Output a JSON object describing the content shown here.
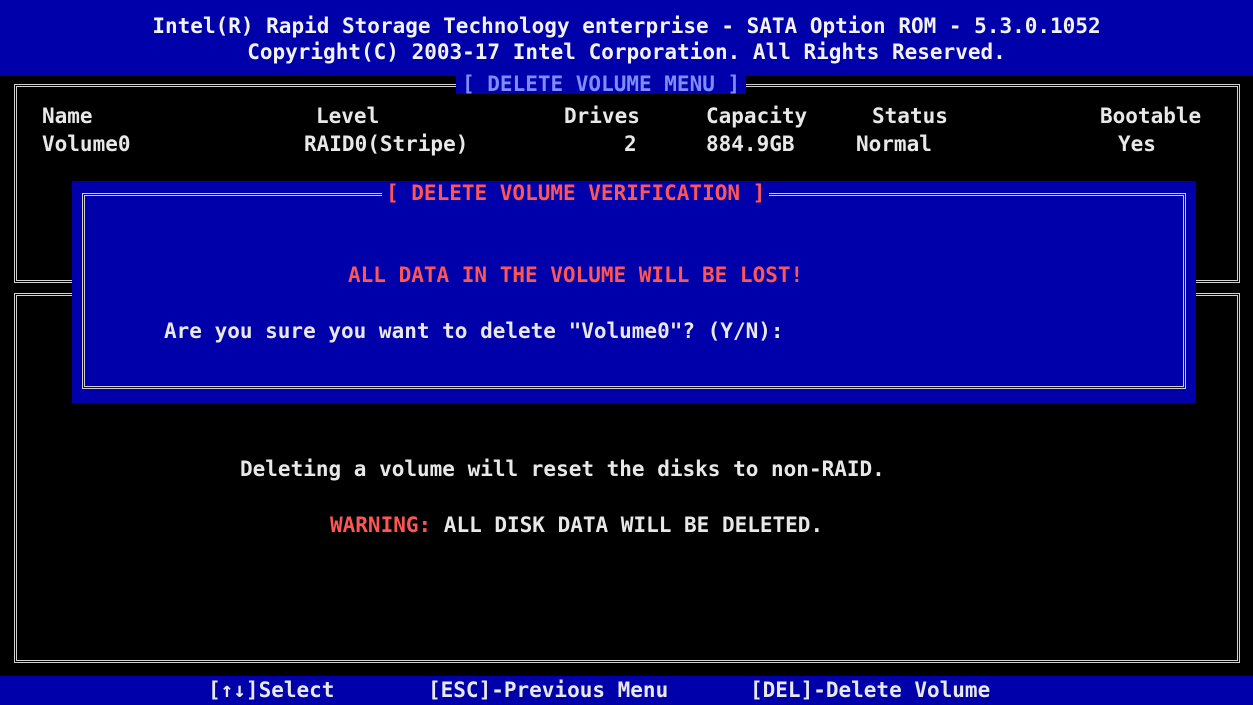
{
  "header": {
    "line1": "Intel(R) Rapid Storage Technology enterprise - SATA Option ROM - 5.3.0.1052",
    "line2": "Copyright(C) 2003-17 Intel Corporation.  All Rights Reserved."
  },
  "delete_menu": {
    "title": "[ DELETE VOLUME MENU ]",
    "columns": [
      "Name",
      "Level",
      "Drives",
      "Capacity",
      "Status",
      "Bootable"
    ],
    "rows": [
      [
        "Volume0",
        "RAID0(Stripe)",
        "2",
        "884.9GB",
        "Normal",
        "Yes"
      ]
    ]
  },
  "verification": {
    "title": "[ DELETE VOLUME VERIFICATION ]",
    "warning": "ALL DATA IN THE VOLUME WILL BE LOST!",
    "prompt": "Are you sure you want to delete \"Volume0\"? (Y/N):"
  },
  "info": {
    "line1": "Deleting a volume will reset the disks to non-RAID.",
    "warning_label": "WARNING:",
    "warning_text": " ALL DISK DATA WILL BE DELETED."
  },
  "footer": {
    "select": "[↑↓]Select",
    "esc": "[ESC]-Previous Menu",
    "del": "[DEL]-Delete Volume"
  },
  "colors": {
    "bios_blue": "#0000aa",
    "warning_red": "#ff5555",
    "text": "#e8e8e8"
  }
}
